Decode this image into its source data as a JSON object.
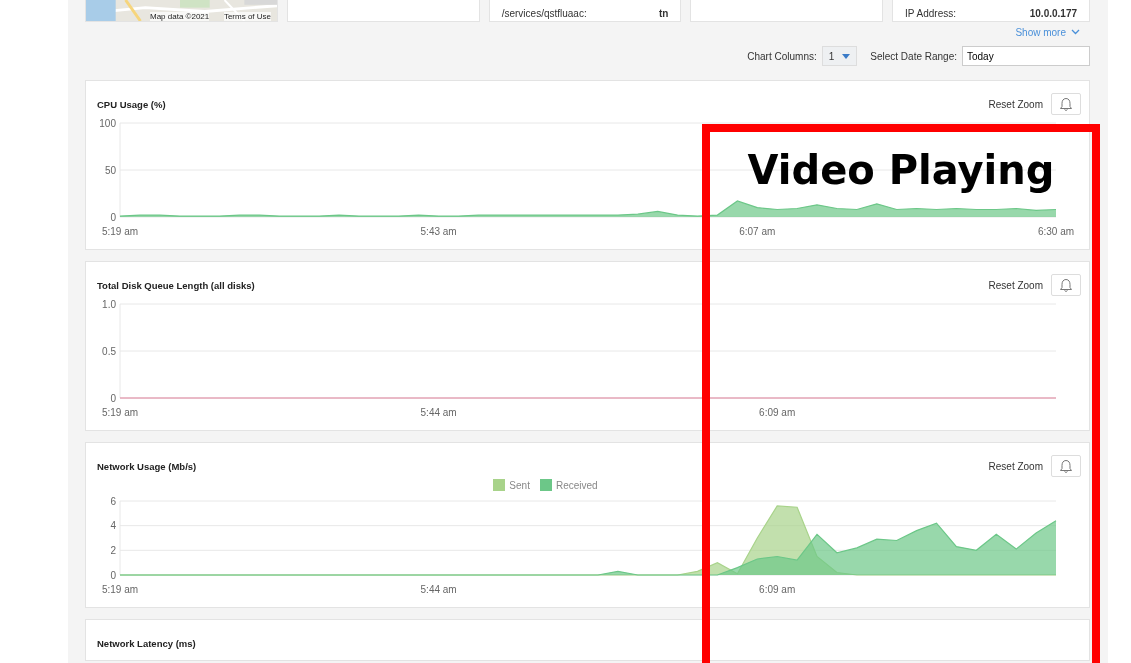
{
  "top_cards": [
    {
      "kind": "map",
      "attribution": "Map data ©2021",
      "terms": "Terms of Use"
    },
    {
      "kind": "empty"
    },
    {
      "kind": "field",
      "label": "/services/qstfluaac:",
      "value": "tn"
    },
    {
      "kind": "empty"
    },
    {
      "kind": "field",
      "label": "IP Address:",
      "value": "10.0.0.177"
    }
  ],
  "show_more": "Show more",
  "controls": {
    "columns_label": "Chart Columns:",
    "columns_value": "1",
    "range_label": "Select Date Range:",
    "range_value": "Today"
  },
  "charts": [
    {
      "title": "CPU Usage (%)",
      "reset": "Reset Zoom",
      "chart_data": {
        "type": "area",
        "categories": [
          "5:19 am",
          null,
          null,
          null,
          null,
          null,
          null,
          null,
          null,
          null,
          null,
          null,
          null,
          null,
          null,
          null,
          "5:43 am",
          null,
          null,
          null,
          null,
          null,
          null,
          null,
          null,
          null,
          null,
          null,
          null,
          null,
          null,
          null,
          "6:07 am",
          null,
          null,
          null,
          null,
          null,
          null,
          null,
          null,
          null,
          null,
          null,
          null,
          null,
          null,
          "6:30 am"
        ],
        "ylim": [
          0,
          100
        ],
        "yticks": [
          0,
          50,
          100
        ],
        "series": [
          {
            "color": "#6cc788",
            "values": [
              1,
              2,
              2,
              1,
              1,
              1,
              2,
              2,
              1,
              1,
              1,
              2,
              1,
              1,
              1,
              2,
              1,
              1,
              2,
              2,
              2,
              2,
              2,
              2,
              2,
              2,
              3,
              6,
              2,
              1,
              2,
              17,
              10,
              8,
              9,
              13,
              9,
              8,
              14,
              8,
              9,
              8,
              9,
              8,
              8,
              9,
              7,
              8
            ]
          }
        ]
      }
    },
    {
      "title": "Total Disk Queue Length (all disks)",
      "reset": "Reset Zoom",
      "chart_data": {
        "type": "line",
        "categories": [
          "5:19 am",
          null,
          null,
          null,
          null,
          null,
          null,
          null,
          null,
          null,
          null,
          null,
          null,
          null,
          null,
          null,
          "5:44 am",
          null,
          null,
          null,
          null,
          null,
          null,
          null,
          null,
          null,
          null,
          null,
          null,
          null,
          null,
          null,
          null,
          "6:09 am",
          null,
          null,
          null,
          null,
          null,
          null,
          null,
          null,
          null,
          null,
          null,
          null,
          null,
          null
        ],
        "ylim": [
          0,
          1
        ],
        "yticks": [
          {
            "value": 0,
            "label": "0"
          },
          {
            "value": 0.5,
            "label": "0.5"
          },
          {
            "value": 1,
            "label": "1.0"
          }
        ],
        "series": [
          {
            "color": "#e0809a",
            "values": [
              0,
              0,
              0,
              0,
              0,
              0,
              0,
              0,
              0,
              0,
              0,
              0,
              0,
              0,
              0,
              0,
              0,
              0,
              0,
              0,
              0,
              0,
              0,
              0,
              0,
              0,
              0,
              0,
              0,
              0,
              0,
              0,
              0,
              0,
              0,
              0,
              0,
              0,
              0,
              0,
              0,
              0,
              0,
              0,
              0,
              0,
              0,
              0
            ]
          }
        ]
      }
    },
    {
      "title": "Network Usage (Mb/s)",
      "reset": "Reset Zoom",
      "chart_data": {
        "type": "area",
        "categories": [
          "5:19 am",
          null,
          null,
          null,
          null,
          null,
          null,
          null,
          null,
          null,
          null,
          null,
          null,
          null,
          null,
          null,
          "5:44 am",
          null,
          null,
          null,
          null,
          null,
          null,
          null,
          null,
          null,
          null,
          null,
          null,
          null,
          null,
          null,
          null,
          "6:09 am",
          null,
          null,
          null,
          null,
          null,
          null,
          null,
          null,
          null,
          null,
          null,
          null,
          null,
          null
        ],
        "ylim": [
          0,
          6
        ],
        "yticks": [
          0,
          2,
          4,
          6
        ],
        "series": [
          {
            "name": "Sent",
            "color": "#a8d38a",
            "values": [
              0,
              0,
              0,
              0,
              0,
              0,
              0,
              0,
              0,
              0,
              0,
              0,
              0,
              0,
              0,
              0,
              0,
              0,
              0,
              0,
              0,
              0,
              0,
              0,
              0,
              0,
              0,
              0,
              0,
              0.3,
              1,
              0.1,
              3,
              5.6,
              5.5,
              1.5,
              0.2,
              0,
              0,
              0,
              0,
              0,
              0,
              0,
              0,
              0,
              0,
              0
            ]
          },
          {
            "name": "Received",
            "color": "#6cc788",
            "values": [
              0,
              0,
              0,
              0,
              0,
              0,
              0,
              0,
              0,
              0,
              0,
              0,
              0,
              0,
              0,
              0,
              0,
              0,
              0,
              0,
              0,
              0,
              0,
              0,
              0,
              0.3,
              0,
              0,
              0,
              0,
              0,
              0.6,
              1.3,
              1.5,
              1.2,
              3.3,
              1.8,
              2.2,
              2.9,
              2.8,
              3.6,
              4.2,
              2.3,
              2,
              3.3,
              2.1,
              3.4,
              4.4
            ]
          }
        ]
      }
    },
    {
      "title": "Network Latency (ms)"
    }
  ],
  "annotation": {
    "text": "Video Playing"
  }
}
